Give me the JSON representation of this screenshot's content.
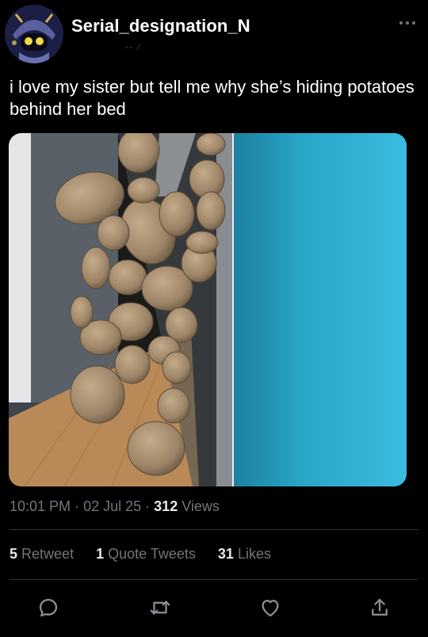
{
  "tweet": {
    "username": "Serial_designation_N",
    "text": "i love my sister but tell me why she’s hiding potatoes behind her bed",
    "time": "10:01 PM",
    "date": "02 Jul 25",
    "separator": "·",
    "views_count": "312",
    "views_label": "Views"
  },
  "stats": {
    "retweets_count": "5",
    "retweets_label": "Retweet",
    "quotes_count": "1",
    "quotes_label": "Quote Tweets",
    "likes_count": "31",
    "likes_label": "Likes"
  },
  "icons": {
    "more": "more-icon",
    "reply": "reply-icon",
    "retweet": "retweet-icon",
    "like": "heart-icon",
    "share": "share-icon"
  },
  "colors": {
    "background": "#000000",
    "text": "#e7e9ea",
    "muted": "#71767b",
    "divider": "#2f3336"
  }
}
